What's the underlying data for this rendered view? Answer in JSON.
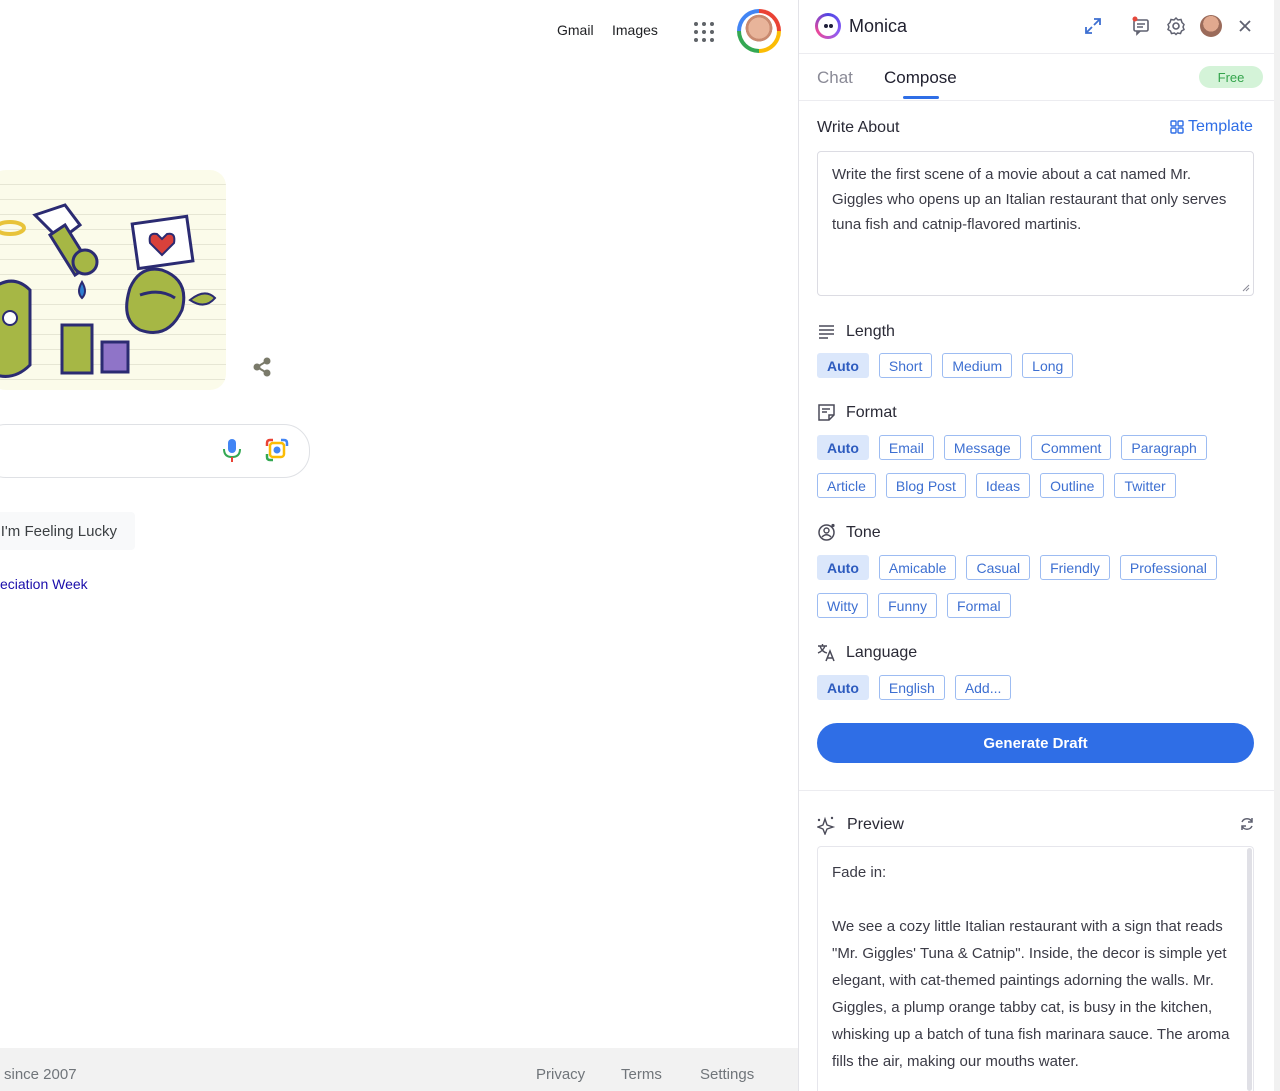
{
  "google": {
    "gmail": "Gmail",
    "images": "Images",
    "lucky_button": "I'm Feeling Lucky",
    "doodle_link": "eciation Week",
    "footer": {
      "since": "since 2007",
      "privacy": "Privacy",
      "terms": "Terms",
      "settings": "Settings"
    }
  },
  "monica": {
    "title": "Monica",
    "tabs": {
      "chat": "Chat",
      "compose": "Compose"
    },
    "badge": "Free",
    "write_about": "Write About",
    "template": "Template",
    "prompt_value": "Write the first scene of a movie about a cat named Mr. Giggles who opens up an Italian restaurant that only serves tuna fish and catnip-flavored martinis.",
    "sections": {
      "length": {
        "label": "Length",
        "options": [
          "Auto",
          "Short",
          "Medium",
          "Long"
        ]
      },
      "format": {
        "label": "Format",
        "options": [
          "Auto",
          "Email",
          "Message",
          "Comment",
          "Paragraph",
          "Article",
          "Blog Post",
          "Ideas",
          "Outline",
          "Twitter"
        ]
      },
      "tone": {
        "label": "Tone",
        "options": [
          "Auto",
          "Amicable",
          "Casual",
          "Friendly",
          "Professional",
          "Witty",
          "Funny",
          "Formal"
        ]
      },
      "language": {
        "label": "Language",
        "options": [
          "Auto",
          "English",
          "Add..."
        ]
      }
    },
    "generate_button": "Generate Draft",
    "preview": {
      "label": "Preview",
      "line1": "Fade in:",
      "para": "We see a cozy little Italian restaurant with a sign that reads \"Mr. Giggles' Tuna & Catnip\". Inside, the decor is simple yet elegant, with cat-themed paintings adorning the walls. Mr. Giggles, a plump orange tabby cat, is busy in the kitchen, whisking up a batch of tuna fish marinara sauce. The aroma fills the air, making our mouths water."
    },
    "colors": {
      "accent": "#2f6ee6",
      "free_badge_bg": "#d4f3d8",
      "free_badge_text": "#34a44c"
    }
  }
}
